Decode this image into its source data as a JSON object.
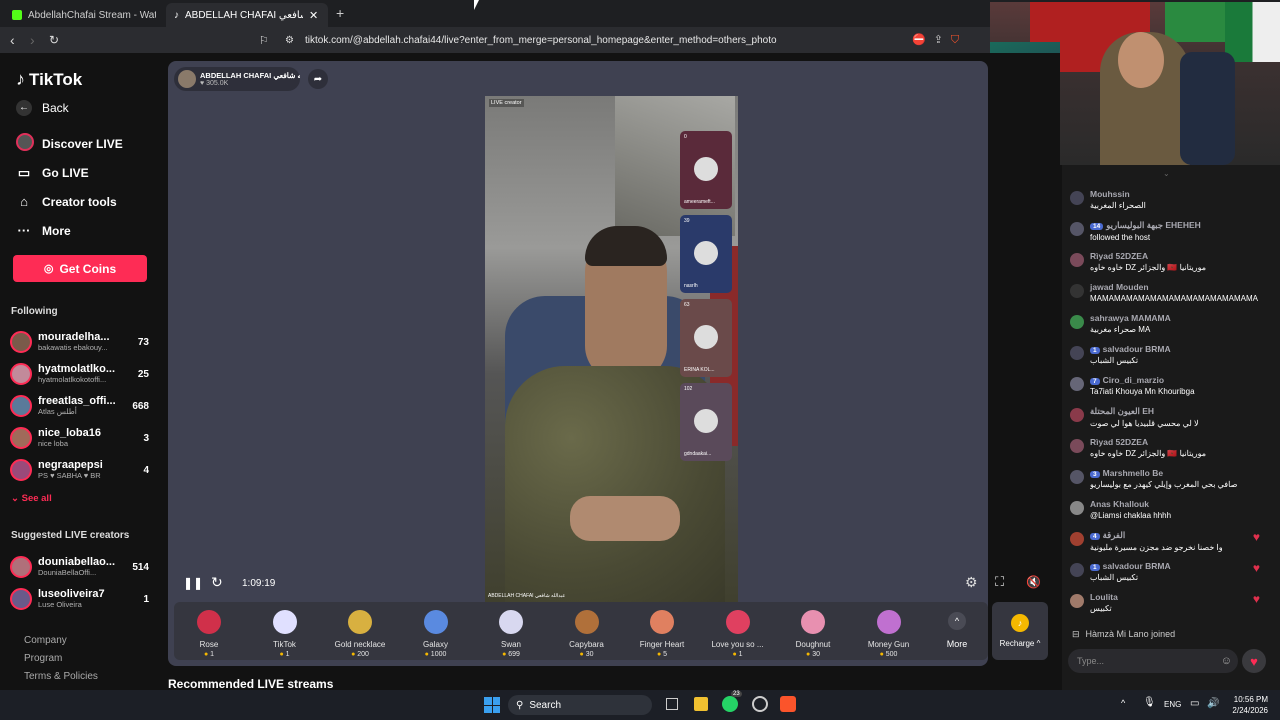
{
  "browser": {
    "tabs": [
      {
        "title": "AbdellahChafai Stream - Watch Live"
      },
      {
        "title": "ABDELLAH CHAFAI عبدالله شافعي"
      }
    ],
    "url": "tiktok.com/@abdellah.chafai44/live?enter_from_merge=personal_homepage&enter_method=others_photo"
  },
  "sidebar": {
    "logo": "TikTok",
    "back": "Back",
    "nav": [
      {
        "label": "Discover LIVE",
        "icon": "avatar-icon"
      },
      {
        "label": "Go LIVE",
        "icon": "camera-icon"
      },
      {
        "label": "Creator tools",
        "icon": "home-icon"
      },
      {
        "label": "More",
        "icon": "ellipsis-icon"
      }
    ],
    "coins_button": "Get Coins",
    "following_title": "Following",
    "following": [
      {
        "name": "mouradelha...",
        "sub": "bakawatis ebakouy...",
        "count": "73",
        "color": "#7a5a4a"
      },
      {
        "name": "hyatmolatlko...",
        "sub": "hyatmolatlkokotoffi...",
        "count": "25",
        "color": "#c28a9a"
      },
      {
        "name": "freeatlas_offi...",
        "sub": "Atlas أطلس",
        "count": "668",
        "color": "#5a7a9a"
      },
      {
        "name": "nice_loba16",
        "sub": "nice loba",
        "count": "3",
        "color": "#a06a5a"
      },
      {
        "name": "negraapepsi",
        "sub": "PS ♥ SABHA ♥ BR",
        "count": "4",
        "color": "#9a4a7a"
      }
    ],
    "see_all": "See all",
    "suggested_title": "Suggested LIVE creators",
    "suggested": [
      {
        "name": "douniabellao...",
        "sub": "DouniaBellaOffi...",
        "count": "514",
        "color": "#b0707a"
      },
      {
        "name": "luseoliveira7",
        "sub": "Luse Oliveira",
        "count": "1",
        "color": "#6a5a8a"
      }
    ],
    "footer": [
      "Company",
      "Program",
      "Terms & Policies"
    ],
    "recommended": "Recommended LIVE streams"
  },
  "stream": {
    "host_name": "ABDELLAH CHAFAI عبدالله شافعي",
    "likes": "305.0K",
    "badge": "LIVE creator",
    "watermark": "ABDELLAH CHAFAI عبدالله شافعي",
    "time": "1:09:19",
    "participants": [
      {
        "label": "ameerameft...",
        "score": "0"
      },
      {
        "label": "nasrlh",
        "score": "39"
      },
      {
        "label": "ERINA KOL...",
        "score": "63"
      },
      {
        "label": "gdndaakai...",
        "score": "102"
      }
    ]
  },
  "gifts": [
    {
      "name": "Rose",
      "price": "1",
      "color": "#d0304a"
    },
    {
      "name": "TikTok",
      "price": "1",
      "color": "#e0e0ff"
    },
    {
      "name": "Gold necklace",
      "price": "200",
      "color": "#d8b040"
    },
    {
      "name": "Galaxy",
      "price": "1000",
      "color": "#5a8ae0"
    },
    {
      "name": "Swan",
      "price": "699",
      "color": "#d8d8f0"
    },
    {
      "name": "Capybara",
      "price": "30",
      "color": "#b0703a"
    },
    {
      "name": "Finger Heart",
      "price": "5",
      "color": "#e08060"
    },
    {
      "name": "Love you so ...",
      "price": "1",
      "color": "#e04060"
    },
    {
      "name": "Doughnut",
      "price": "30",
      "color": "#e890b0"
    },
    {
      "name": "Money Gun",
      "price": "500",
      "color": "#c070d0"
    }
  ],
  "more_gifts": "More",
  "recharge": "Recharge",
  "chat": {
    "messages": [
      {
        "user": "Mouhssin",
        "text": "الصحراء المغربية",
        "level": "",
        "heart": false
      },
      {
        "user": "جبهة البوليساريو EHEHEH",
        "text": "followed the host",
        "level": "14",
        "heart": false
      },
      {
        "user": "Rìyad 52DZEA",
        "text": "خاوه خاوه DZ والجزائر 🇲🇦 موريتانيا",
        "level": "",
        "heart": false
      },
      {
        "user": "jawad Mouden",
        "text": "MAMAMAMAMAMAMAMAMAMAMAMAMAMA",
        "level": "",
        "heart": false
      },
      {
        "user": "sahrawya MAMAMA",
        "text": "صحراء مغربية MA",
        "level": "",
        "heart": false
      },
      {
        "user": "salvadour BRMA",
        "text": "تكبيس الشباب",
        "level": "1",
        "heart": false
      },
      {
        "user": "Ciro_di_marzio",
        "text": "Ta7iati Khouya Mn Khouribga",
        "level": "7",
        "heart": false
      },
      {
        "user": "العيون المحتلة EH",
        "text": "لا لي محسي قلبيديا هوا لي صوت",
        "level": "",
        "heart": false
      },
      {
        "user": "Rìyad 52DZEA",
        "text": "خاوه خاوه DZ والجزائر 🇲🇦 موريتانيا",
        "level": "",
        "heart": false
      },
      {
        "user": "Marshmello Be",
        "text": "صافي بحي المغرب وإيلي كيهدر مع بوليساريو",
        "level": "3",
        "heart": false
      },
      {
        "user": "Anas Khallouk",
        "text": "@Liamsi chaklaa hhhh",
        "level": "",
        "heart": false
      },
      {
        "user": "الفرقة",
        "text": "وا خصنا نخرجو ضد مجزن مسيرة مليونية",
        "level": "4",
        "heart": true
      },
      {
        "user": "salvadour BRMA",
        "text": "تكبيس الشباب",
        "level": "1",
        "heart": true
      },
      {
        "user": "Loulita",
        "text": "تكبيس",
        "level": "",
        "heart": true
      }
    ],
    "joined": "Hàmzà Mi Lano joined",
    "placeholder": "Type..."
  },
  "taskbar": {
    "search": "Search",
    "lang": "ENG",
    "time": "10:56 PM",
    "date": "2/24/2026",
    "notif": "23"
  }
}
